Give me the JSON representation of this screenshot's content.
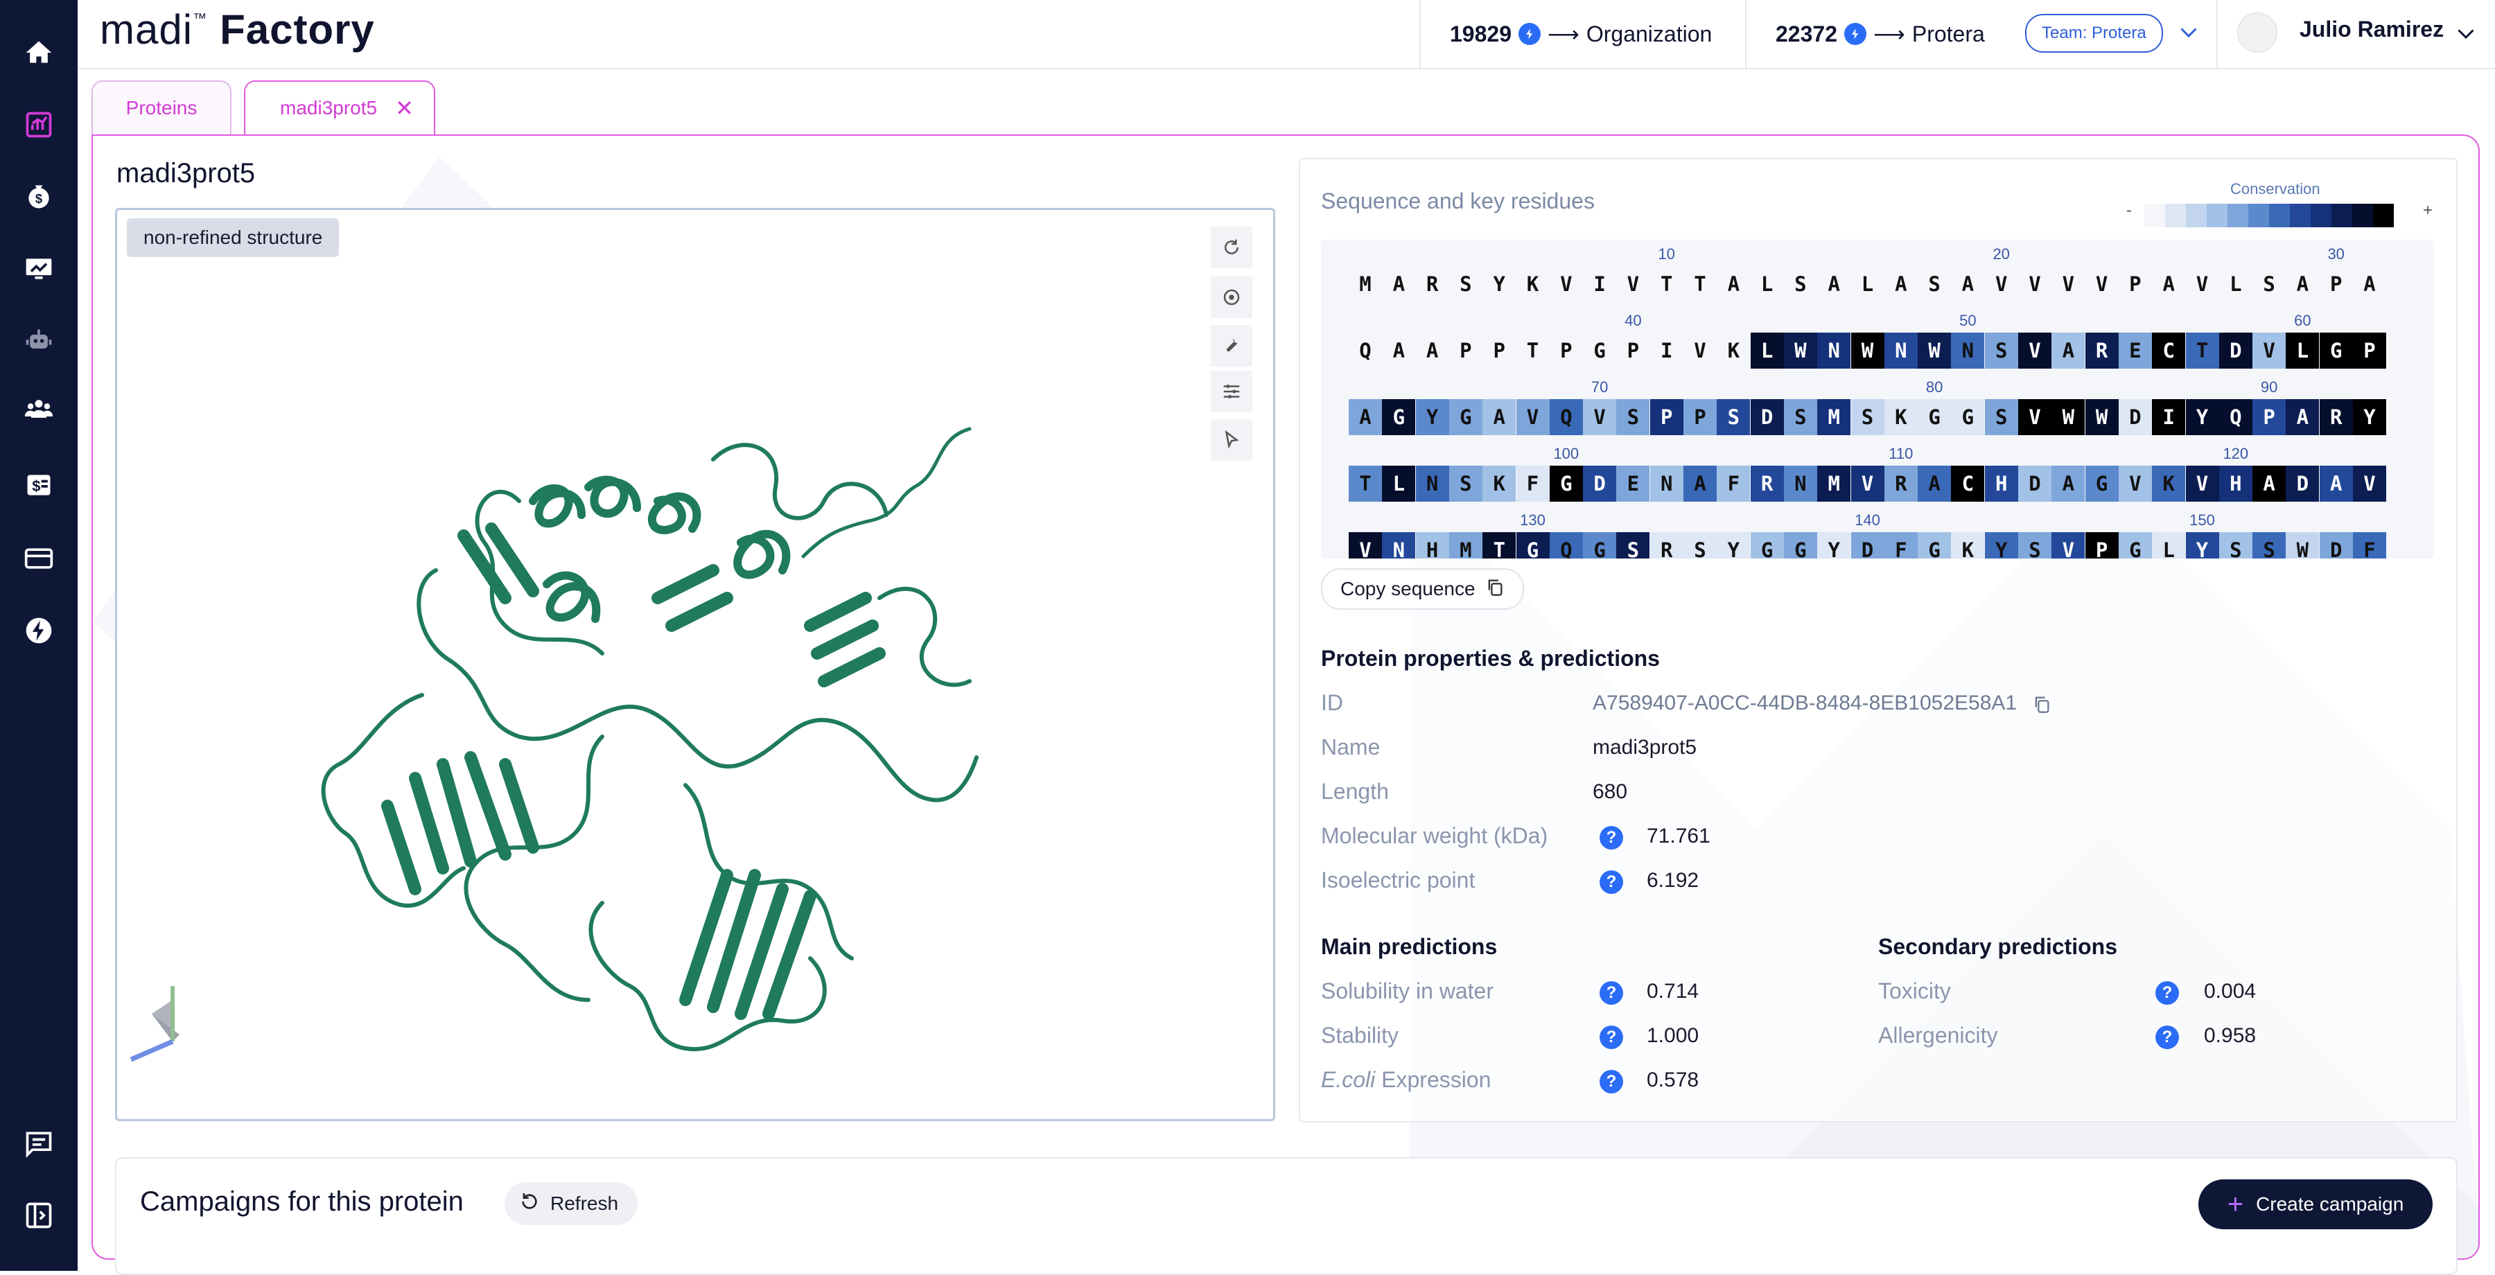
{
  "app": {
    "logo_part1": "madi",
    "logo_tm": "™",
    "logo_part2": "Factory"
  },
  "header": {
    "credits": [
      {
        "amount": "19829",
        "target": "Organization"
      },
      {
        "amount": "22372",
        "target": "Protera"
      }
    ],
    "team_label": "Team: Protera",
    "user_name": "Julio Ramirez"
  },
  "sidebar": {
    "items": [
      {
        "icon": "home-icon"
      },
      {
        "icon": "analytics-icon",
        "active": true
      },
      {
        "icon": "money-icon"
      },
      {
        "icon": "experiments-icon"
      },
      {
        "icon": "robot-icon"
      },
      {
        "icon": "team-icon"
      },
      {
        "icon": "billing-icon"
      },
      {
        "icon": "credit-card-icon"
      },
      {
        "icon": "bolt-icon"
      }
    ],
    "bottom_items": [
      {
        "icon": "chat-icon"
      },
      {
        "icon": "collapse-sidebar-icon"
      }
    ]
  },
  "tabs": [
    {
      "label": "Proteins",
      "active": false
    },
    {
      "label": "madi3prot5",
      "active": true,
      "closable": true
    }
  ],
  "protein": {
    "title": "madi3prot5",
    "structure_badge": "non-refined structure"
  },
  "sequence": {
    "title": "Sequence and key residues",
    "conservation_label": "Conservation",
    "conservation_minus": "-",
    "conservation_plus": "+",
    "conservation_colors": [
      "#f4f6fa",
      "#dde7f5",
      "#c3d5ee",
      "#a2c1e6",
      "#7ea6da",
      "#5b89cc",
      "#3a69b8",
      "#23489a",
      "#14317a",
      "#0c1d52",
      "#060e2e",
      "#000000"
    ],
    "copy_label": "Copy sequence",
    "rows": [
      {
        "start": 1,
        "residues": "MARSYKVIVTTALSALASAVVVVPAVLSAPA",
        "levels": [
          0,
          0,
          0,
          0,
          0,
          0,
          0,
          0,
          0,
          0,
          0,
          0,
          0,
          0,
          0,
          0,
          0,
          0,
          0,
          0,
          0,
          0,
          0,
          0,
          0,
          0,
          0,
          0,
          0,
          0,
          0
        ]
      },
      {
        "start": 32,
        "residues": "QAAPPTPGPIVKLWNWNWNSVARECTDVLGP",
        "levels": [
          0,
          0,
          0,
          0,
          0,
          0,
          0,
          0,
          0,
          0,
          0,
          0,
          10,
          9,
          8,
          11,
          7,
          9,
          6,
          4,
          10,
          3,
          9,
          4,
          11,
          6,
          10,
          3,
          11,
          11,
          11
        ]
      },
      {
        "start": 63,
        "residues": "AGYGAVQVSPPSDSMSKGGSVWWDIYQPARY",
        "levels": [
          4,
          10,
          5,
          4,
          3,
          4,
          6,
          3,
          4,
          8,
          4,
          7,
          9,
          4,
          8,
          2,
          1,
          1,
          1,
          4,
          11,
          11,
          10,
          1,
          11,
          10,
          10,
          7,
          9,
          10,
          11
        ]
      },
      {
        "start": 94,
        "residues": "TLNSKFGDENAFRNMVRACHDAGVKVHADAV",
        "levels": [
          5,
          10,
          6,
          4,
          3,
          1,
          11,
          7,
          4,
          3,
          6,
          3,
          7,
          5,
          9,
          8,
          4,
          6,
          11,
          7,
          3,
          4,
          5,
          3,
          6,
          9,
          8,
          11,
          9,
          7,
          9
        ]
      },
      {
        "start": 125,
        "residues": "VNHMTGQGSRSYGGYDFGKYSVPGLYSSWDF",
        "levels": [
          10,
          7,
          3,
          4,
          10,
          9,
          6,
          5,
          9,
          1,
          1,
          1,
          3,
          4,
          1,
          4,
          4,
          3,
          1,
          6,
          4,
          7,
          11,
          3,
          1,
          7,
          3,
          6,
          2,
          4,
          6
        ]
      }
    ],
    "ticks": [
      {
        "row": 0,
        "col": 9,
        "label": "10"
      },
      {
        "row": 0,
        "col": 19,
        "label": "20"
      },
      {
        "row": 0,
        "col": 29,
        "label": "30"
      },
      {
        "row": 1,
        "col": 8,
        "label": "40"
      },
      {
        "row": 1,
        "col": 18,
        "label": "50"
      },
      {
        "row": 1,
        "col": 28,
        "label": "60"
      },
      {
        "row": 2,
        "col": 7,
        "label": "70"
      },
      {
        "row": 2,
        "col": 17,
        "label": "80"
      },
      {
        "row": 2,
        "col": 27,
        "label": "90"
      },
      {
        "row": 3,
        "col": 6,
        "label": "100"
      },
      {
        "row": 3,
        "col": 16,
        "label": "110"
      },
      {
        "row": 3,
        "col": 26,
        "label": "120"
      },
      {
        "row": 4,
        "col": 5,
        "label": "130"
      },
      {
        "row": 4,
        "col": 15,
        "label": "140"
      },
      {
        "row": 4,
        "col": 25,
        "label": "150"
      }
    ]
  },
  "properties": {
    "title": "Protein properties & predictions",
    "id_label": "ID",
    "id_value": "A7589407-A0CC-44DB-8484-8EB1052E58A1",
    "name_label": "Name",
    "name_value": "madi3prot5",
    "length_label": "Length",
    "length_value": "680",
    "mw_label": "Molecular weight (kDa)",
    "mw_value": "71.761",
    "pi_label": "Isoelectric point",
    "pi_value": "6.192"
  },
  "main_predictions": {
    "title": "Main predictions",
    "solubility_label": "Solubility in water",
    "solubility_value": "0.714",
    "stability_label": "Stability",
    "stability_value": "1.000",
    "ecoli_label_italic": "E.coli",
    "ecoli_label_rest": " Expression",
    "ecoli_value": "0.578"
  },
  "secondary_predictions": {
    "title": "Secondary predictions",
    "toxicity_label": "Toxicity",
    "toxicity_value": "0.004",
    "allergenicity_label": "Allergenicity",
    "allergenicity_value": "0.958"
  },
  "campaigns": {
    "title": "Campaigns for this protein",
    "refresh_label": "Refresh",
    "create_label": "Create campaign"
  },
  "colors": {
    "sidebar_bg": "#0f1736",
    "accent": "#d33ad6",
    "protein": "#1f7a5e",
    "help": "#2b6cf6"
  }
}
